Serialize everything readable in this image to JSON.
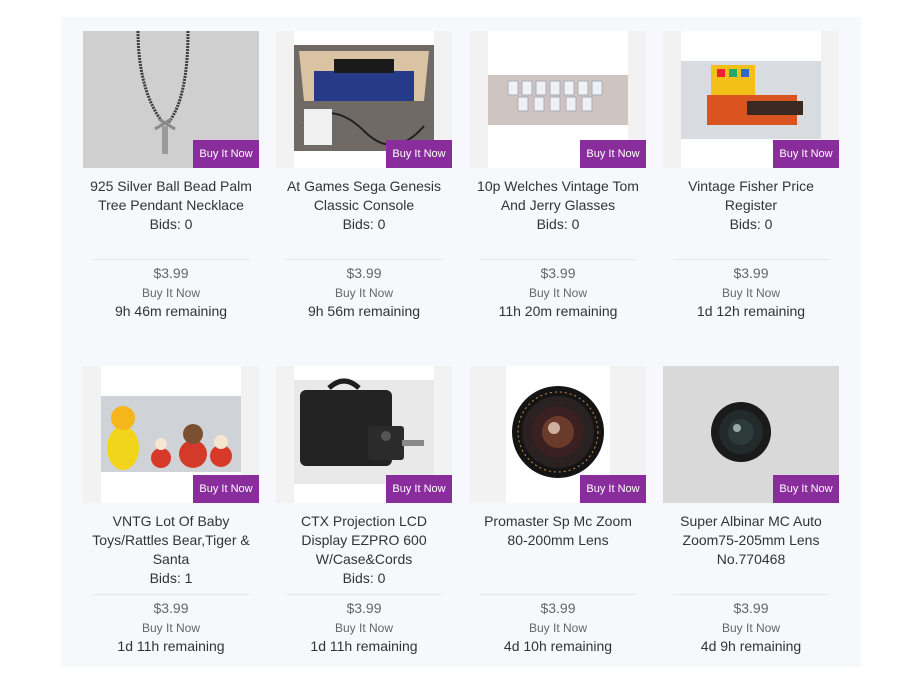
{
  "listing": {
    "items": [
      {
        "title": "925 Silver Ball Bead Palm Tree Pendant Necklace",
        "bids": "Bids: 0",
        "price": "$3.99",
        "format": "Buy It Now",
        "badge": "Buy It Now",
        "remaining": "9h 46m remaining",
        "image": "silver-necklace-photo"
      },
      {
        "title": "At Games Sega Genesis Classic Console",
        "bids": "Bids: 0",
        "price": "$3.99",
        "format": "Buy It Now",
        "badge": "Buy It Now",
        "remaining": "9h 56m remaining",
        "image": "game-console-box-photo"
      },
      {
        "title": "10p Welches Vintage Tom And Jerry Glasses",
        "bids": "Bids: 0",
        "price": "$3.99",
        "format": "Buy It Now",
        "badge": "Buy It Now",
        "remaining": "11h 20m remaining",
        "image": "glasses-row-photo"
      },
      {
        "title": "Vintage Fisher Price Register",
        "bids": "Bids: 0",
        "price": "$3.99",
        "format": "Buy It Now",
        "badge": "Buy It Now",
        "remaining": "1d 12h remaining",
        "image": "toy-register-photo"
      },
      {
        "title": "VNTG Lot Of Baby Toys/Rattles Bear,Tiger & Santa",
        "bids": "Bids: 1",
        "price": "$3.99",
        "format": "Buy It Now",
        "badge": "Buy It Now",
        "remaining": "1d 11h remaining",
        "image": "baby-toys-photo"
      },
      {
        "title": "CTX Projection LCD Display EZPRO 600 W/Case&Cords",
        "bids": "Bids: 0",
        "price": "$3.99",
        "format": "Buy It Now",
        "badge": "Buy It Now",
        "remaining": "1d 11h remaining",
        "image": "projector-case-photo"
      },
      {
        "title": "Promaster Sp Mc Zoom 80-200mm Lens",
        "bids": "",
        "price": "$3.99",
        "format": "Buy It Now",
        "badge": "Buy It Now",
        "remaining": "4d 10h remaining",
        "image": "zoom-lens-photo"
      },
      {
        "title": "Super Albinar MC Auto Zoom75-205mm Lens No.770468",
        "bids": "",
        "price": "$3.99",
        "format": "Buy It Now",
        "badge": "Buy It Now",
        "remaining": "4d 9h remaining",
        "image": "zoom-lens-photo-2"
      }
    ]
  },
  "colors": {
    "badge_bg": "#8a2d9c",
    "panel_bg": "#f7f8fc",
    "text_dark": "#333333",
    "text_muted": "#666666"
  }
}
